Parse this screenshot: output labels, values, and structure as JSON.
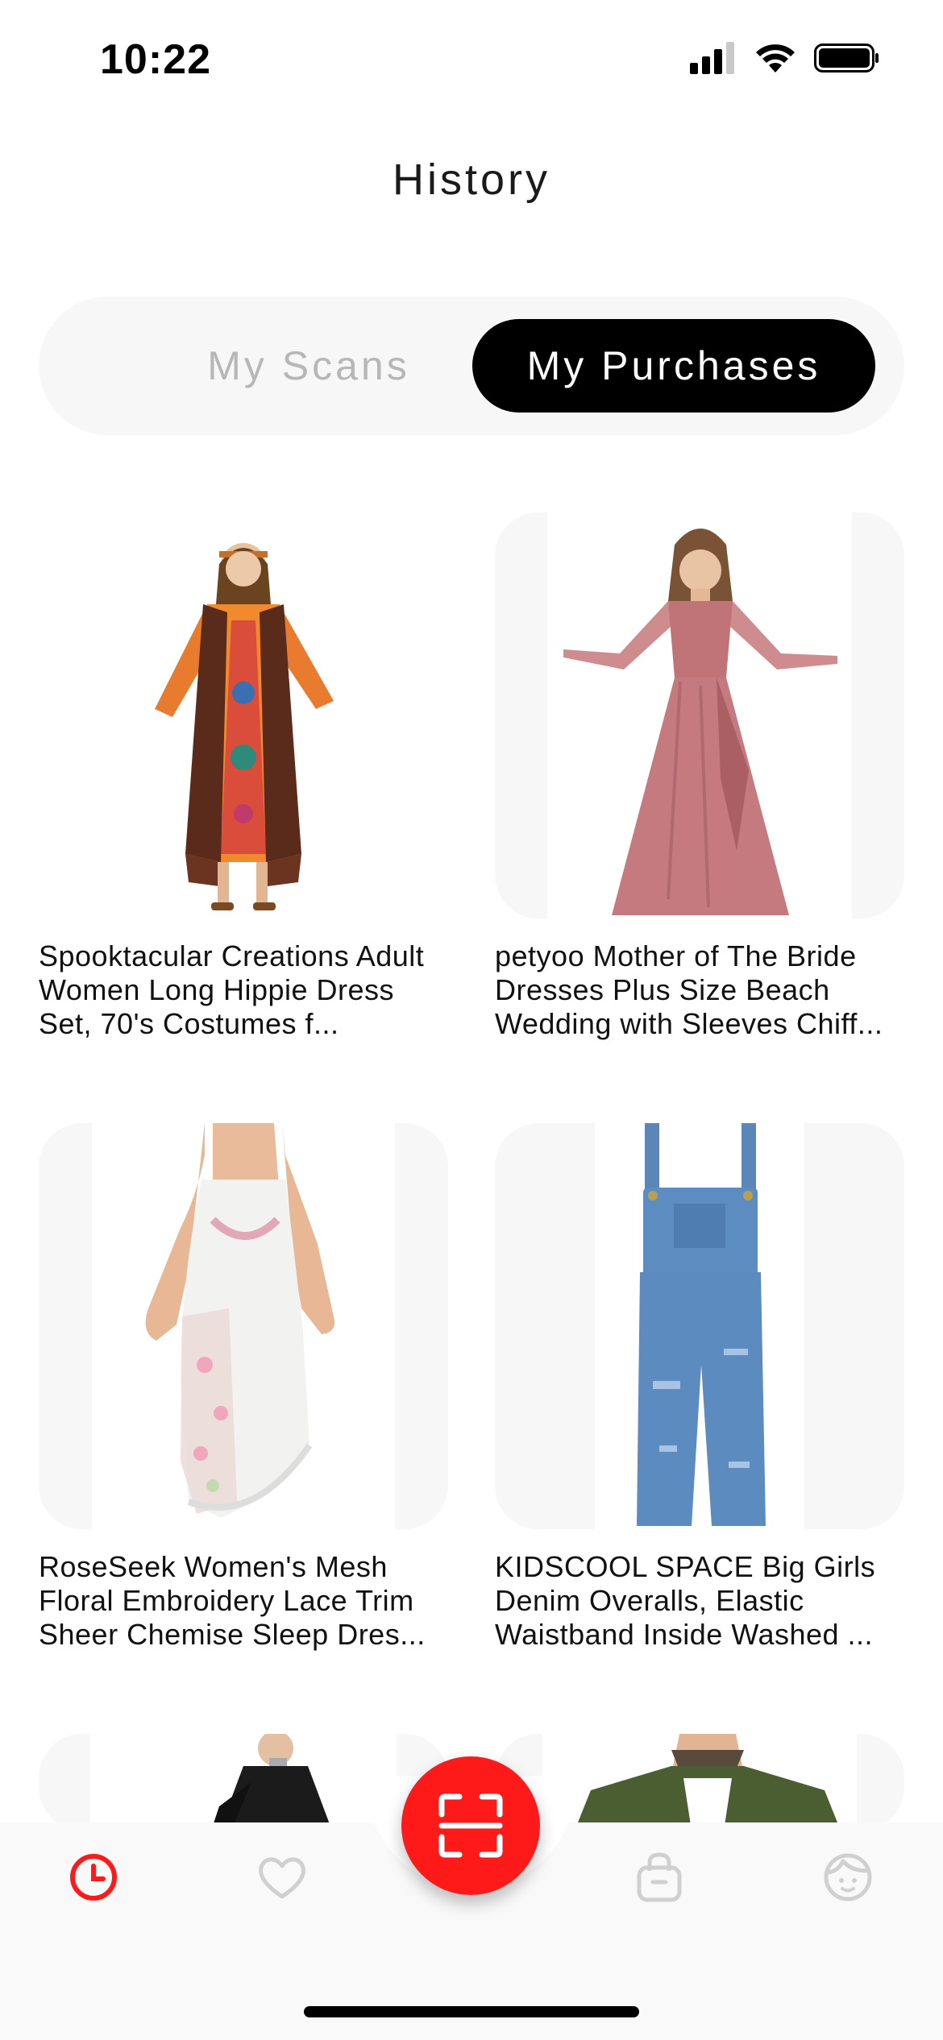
{
  "status_bar": {
    "time": "10:22"
  },
  "header": {
    "title": "History"
  },
  "segmented": {
    "scans_label": "My Scans",
    "purchases_label": "My Purchases",
    "selected": "My Purchases"
  },
  "products": [
    {
      "title": "Spooktacular Creations Adult Women Long Hippie Dress Set, 70's Costumes f..."
    },
    {
      "title": "petyoo Mother of The Bride Dresses Plus Size Beach Wedding with Sleeves Chiff..."
    },
    {
      "title": "RoseSeek Women's Mesh Floral Embroidery Lace Trim Sheer Chemise Sleep Dres..."
    },
    {
      "title": "KIDSCOOL SPACE Big Girls Denim Overalls, Elastic Waistband Inside Washed ..."
    }
  ],
  "tabbar": {
    "items": [
      "history-icon",
      "heart-icon",
      "scan-icon",
      "bag-icon",
      "profile-icon"
    ],
    "active": "history",
    "accent_color": "#ff1a1a",
    "inactive_color": "#cfcfcf"
  }
}
